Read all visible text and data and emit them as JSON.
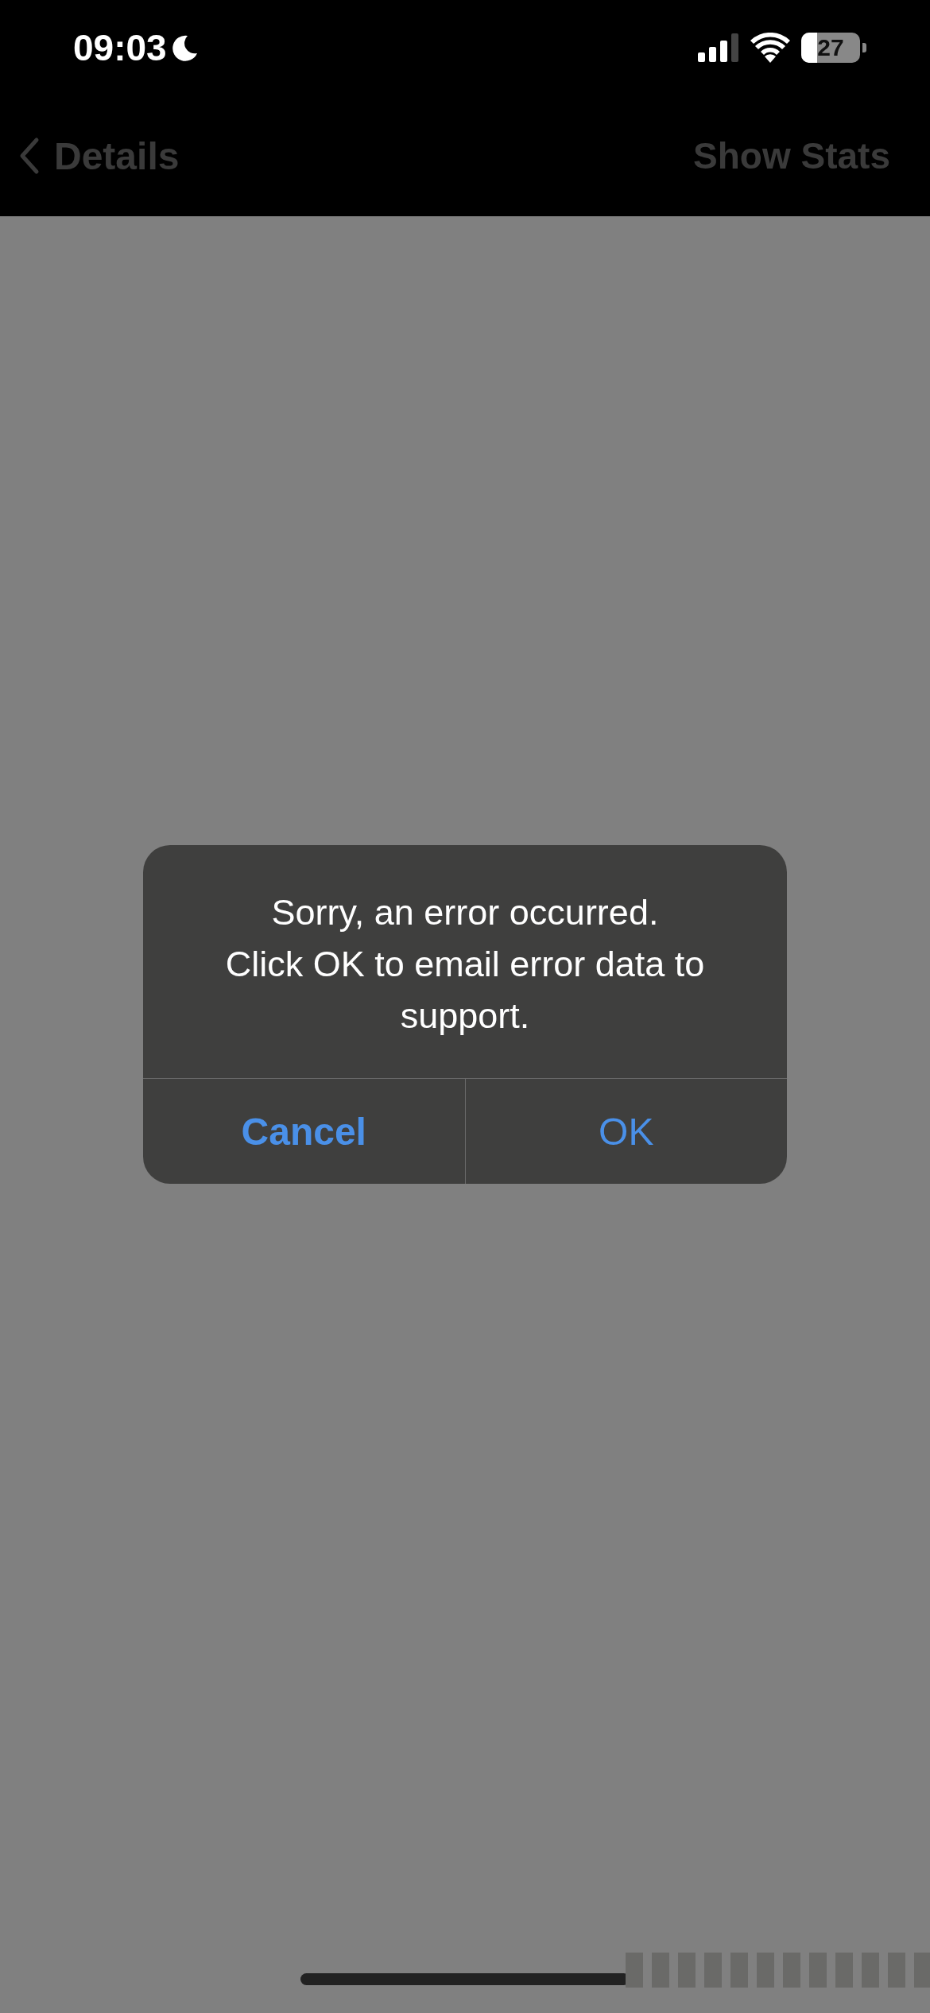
{
  "status_bar": {
    "time": "09:03",
    "battery": "27"
  },
  "nav_bar": {
    "back_label": "Details",
    "action": "Show Stats"
  },
  "alert": {
    "message": "Sorry, an error occurred.\nClick OK to email error data to support.",
    "buttons": [
      {
        "label": "Cancel",
        "kind": "cancel"
      },
      {
        "label": "OK",
        "kind": "default"
      }
    ]
  }
}
